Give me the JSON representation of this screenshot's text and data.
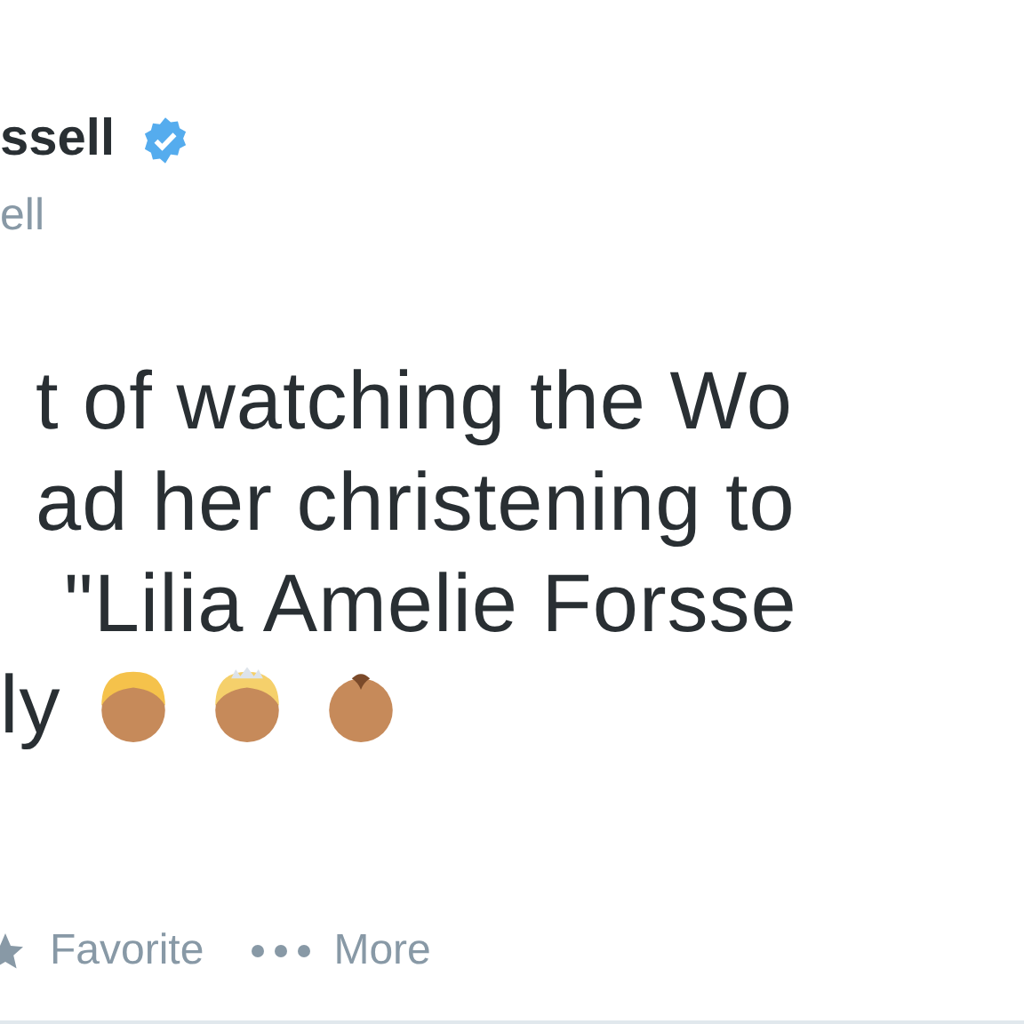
{
  "author": {
    "name": "ssell",
    "verified": true,
    "handle": "ell"
  },
  "tweet": {
    "lines": [
      "t of watching the Wo",
      "ad her christening to",
      "\"Lilia Amelie Forsse",
      "ly"
    ]
  },
  "actions": [
    {
      "kind": "favorite",
      "label": "Favorite"
    },
    {
      "kind": "more",
      "label": "More"
    }
  ]
}
